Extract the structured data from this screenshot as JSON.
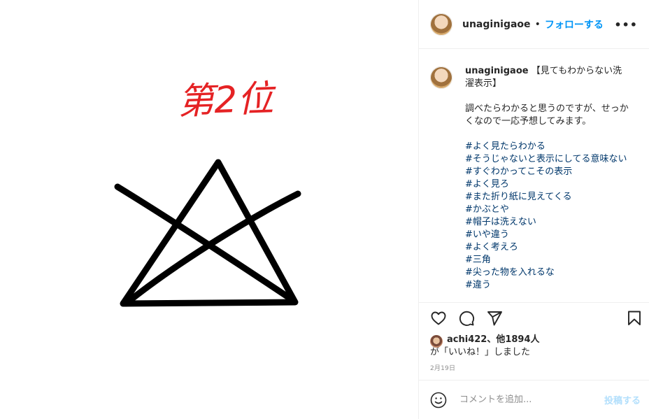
{
  "image": {
    "handwritten_title": "第2位",
    "title_color": "#e52224"
  },
  "header": {
    "username": "unaginigaoe",
    "separator": "•",
    "follow_label": "フォローする",
    "more_icon": "more-dots-icon"
  },
  "caption": {
    "username": "unaginigaoe",
    "title": "【見てもわからない洗濯表示】",
    "body": "調べたらわかると思うのですが、せっかくなので一応予想してみます。",
    "hashtags": [
      "#よく見たらわかる",
      "#そうじゃないと表示にしてる意味ない",
      "#すぐわかってこその表示",
      "#よく見ろ",
      "#また折り紙に見えてくる",
      "#かぶとや",
      "#帽子は洗えない",
      "#いや違う",
      "#よく考えろ",
      "#三角",
      "#尖った物を入れるな",
      "#違う"
    ]
  },
  "actions": {
    "like_icon": "heart-icon",
    "comment_icon": "comment-icon",
    "share_icon": "share-icon",
    "save_icon": "bookmark-icon"
  },
  "likes": {
    "users": "achi422、他1894人",
    "suffix": "が「いいね！」しました"
  },
  "date": "2月19日",
  "add_comment": {
    "placeholder": "コメントを追加...",
    "post_label": "投稿する",
    "emoji_icon": "emoji-icon"
  },
  "colors": {
    "link_blue": "#0095f6",
    "hashtag_blue": "#00376b",
    "post_disabled": "#b2dffc"
  }
}
